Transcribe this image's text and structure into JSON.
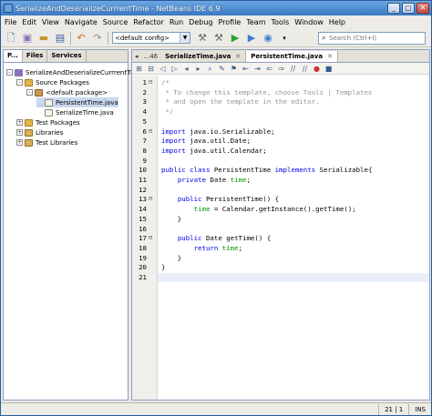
{
  "window": {
    "title": "SerializeAndDeserializeCurrrentTime - NetBeans IDE 6.9",
    "min": "_",
    "max": "□",
    "close": "✕"
  },
  "menu": [
    "File",
    "Edit",
    "View",
    "Navigate",
    "Source",
    "Refactor",
    "Run",
    "Debug",
    "Profile",
    "Team",
    "Tools",
    "Window",
    "Help"
  ],
  "toolbar": {
    "config_value": "<default config>",
    "search_placeholder": "Search (Ctrl+I)"
  },
  "left_panel": {
    "tabs": [
      "P...",
      "Files",
      "Services"
    ],
    "tree": [
      {
        "label": "SerializeAndDeserializeCurrrentTime",
        "level": 0,
        "exp": "-",
        "icon": "proj"
      },
      {
        "label": "Source Packages",
        "level": 1,
        "exp": "-",
        "icon": "pkg"
      },
      {
        "label": "<default package>",
        "level": 2,
        "exp": "-",
        "icon": "box"
      },
      {
        "label": "PersistentTime.java",
        "level": 3,
        "exp": "",
        "icon": "java",
        "selected": true
      },
      {
        "label": "SerializeTime.java",
        "level": 3,
        "exp": "",
        "icon": "java"
      },
      {
        "label": "Test Packages",
        "level": 1,
        "exp": "+",
        "icon": "pkg"
      },
      {
        "label": "Libraries",
        "level": 1,
        "exp": "+",
        "icon": "lib"
      },
      {
        "label": "Test Libraries",
        "level": 1,
        "exp": "+",
        "icon": "lib"
      }
    ]
  },
  "editor": {
    "tab_nav": "...46",
    "tabs": [
      {
        "label": "SerializeTime.java",
        "active": false
      },
      {
        "label": "PersistentTime.java",
        "active": true
      }
    ],
    "lines": [
      {
        "n": "1",
        "fold": "⊟",
        "parts": [
          {
            "t": "/*",
            "c": "cm"
          }
        ]
      },
      {
        "n": "2",
        "fold": "",
        "parts": [
          {
            "t": " * To change this template, choose Tools | Templates",
            "c": "cm"
          }
        ]
      },
      {
        "n": "3",
        "fold": "",
        "parts": [
          {
            "t": " * and open the template in the editor.",
            "c": "cm"
          }
        ]
      },
      {
        "n": "4",
        "fold": "",
        "parts": [
          {
            "t": " */",
            "c": "cm"
          }
        ]
      },
      {
        "n": "5",
        "fold": "",
        "parts": []
      },
      {
        "n": "6",
        "fold": "⊟",
        "parts": [
          {
            "t": "import",
            "c": "kw"
          },
          {
            "t": " java.io.Serializable;",
            "c": ""
          }
        ]
      },
      {
        "n": "7",
        "fold": "",
        "parts": [
          {
            "t": "import",
            "c": "kw"
          },
          {
            "t": " java.util.Date;",
            "c": ""
          }
        ]
      },
      {
        "n": "8",
        "fold": "",
        "parts": [
          {
            "t": "import",
            "c": "kw"
          },
          {
            "t": " java.util.Calendar;",
            "c": ""
          }
        ]
      },
      {
        "n": "9",
        "fold": "",
        "parts": []
      },
      {
        "n": "10",
        "fold": "",
        "parts": [
          {
            "t": "public class",
            "c": "kw"
          },
          {
            "t": " PersistentTime ",
            "c": ""
          },
          {
            "t": "implements",
            "c": "kw"
          },
          {
            "t": " Serializable{",
            "c": ""
          }
        ]
      },
      {
        "n": "11",
        "fold": "",
        "parts": [
          {
            "t": "    ",
            "c": ""
          },
          {
            "t": "private",
            "c": "kw"
          },
          {
            "t": " Date ",
            "c": ""
          },
          {
            "t": "time",
            "c": "fld"
          },
          {
            "t": ";",
            "c": ""
          }
        ]
      },
      {
        "n": "12",
        "fold": "",
        "parts": []
      },
      {
        "n": "13",
        "fold": "⊟",
        "parts": [
          {
            "t": "    ",
            "c": ""
          },
          {
            "t": "public",
            "c": "kw"
          },
          {
            "t": " PersistentTime() {",
            "c": ""
          }
        ]
      },
      {
        "n": "14",
        "fold": "",
        "parts": [
          {
            "t": "        ",
            "c": ""
          },
          {
            "t": "time",
            "c": "fld"
          },
          {
            "t": " = Calendar.",
            "c": ""
          },
          {
            "t": "getInstance",
            "c": ""
          },
          {
            "t": "().getTime();",
            "c": ""
          }
        ]
      },
      {
        "n": "15",
        "fold": "",
        "parts": [
          {
            "t": "    }",
            "c": ""
          }
        ]
      },
      {
        "n": "16",
        "fold": "",
        "parts": []
      },
      {
        "n": "17",
        "fold": "⊟",
        "parts": [
          {
            "t": "    ",
            "c": ""
          },
          {
            "t": "public",
            "c": "kw"
          },
          {
            "t": " Date getTime() {",
            "c": ""
          }
        ]
      },
      {
        "n": "18",
        "fold": "",
        "parts": [
          {
            "t": "        ",
            "c": ""
          },
          {
            "t": "return",
            "c": "kw"
          },
          {
            "t": " ",
            "c": ""
          },
          {
            "t": "time",
            "c": "fld"
          },
          {
            "t": ";",
            "c": ""
          }
        ]
      },
      {
        "n": "19",
        "fold": "",
        "parts": [
          {
            "t": "    }",
            "c": ""
          }
        ]
      },
      {
        "n": "20",
        "fold": "",
        "parts": [
          {
            "t": "}",
            "c": ""
          }
        ]
      },
      {
        "n": "21",
        "fold": "",
        "parts": [],
        "current": true
      }
    ]
  },
  "status": {
    "position": "21 | 1",
    "mode": "INS"
  }
}
